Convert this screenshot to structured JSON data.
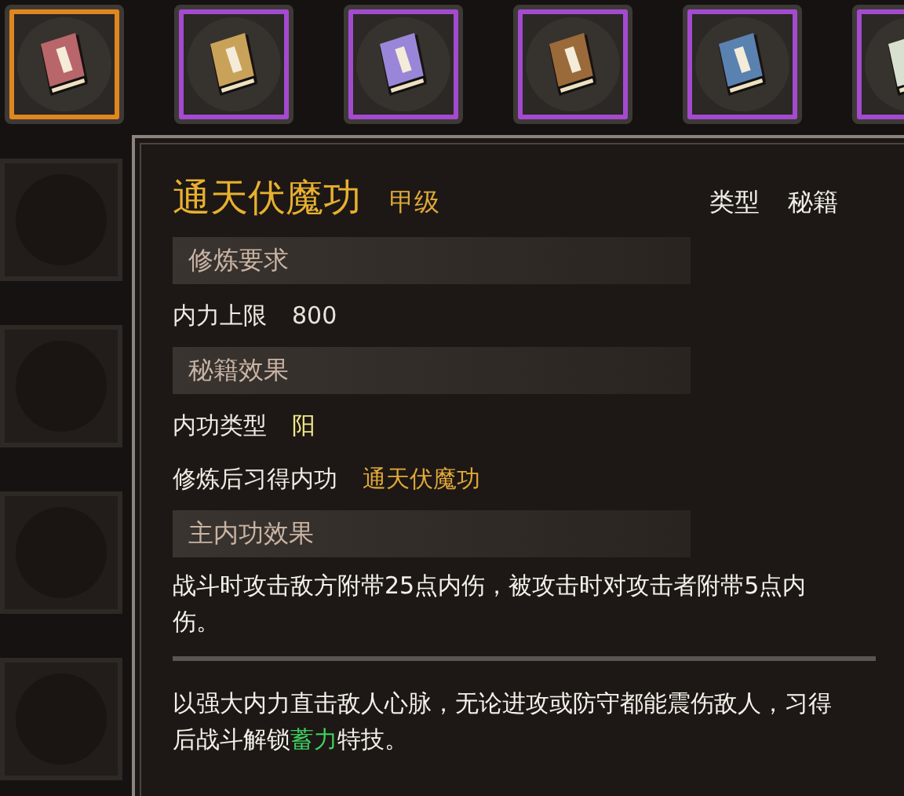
{
  "top_row": [
    {
      "kind": "book",
      "selected": true,
      "color": "#b8666a"
    },
    {
      "kind": "book",
      "selected": false,
      "color": "#c9a25a"
    },
    {
      "kind": "book",
      "selected": false,
      "color": "#9a86d8"
    },
    {
      "kind": "book",
      "selected": false,
      "color": "#9a6a3a"
    },
    {
      "kind": "book",
      "selected": false,
      "color": "#5a82b0"
    },
    {
      "kind": "book",
      "selected": false,
      "color": "#d8e0d0"
    }
  ],
  "side_column": [
    {
      "kind": "empty"
    },
    {
      "kind": "empty"
    },
    {
      "kind": "empty"
    },
    {
      "kind": "empty"
    }
  ],
  "panel": {
    "title": "通天伏魔功",
    "grade": "甲级",
    "type_label": "类型",
    "type_value": "秘籍",
    "sections": [
      {
        "header": "修炼要求",
        "kind": "rows",
        "rows": [
          {
            "label": "内力上限",
            "value": "800",
            "color": "#e8e4dc"
          }
        ]
      },
      {
        "header": "秘籍效果",
        "kind": "rows",
        "rows": [
          {
            "label": "内功类型",
            "value": "阳",
            "color": "#f0e68a"
          },
          {
            "label": "修炼后习得内功",
            "value": "通天伏魔功",
            "color": "#e0a838"
          }
        ]
      },
      {
        "header": "主内功效果",
        "kind": "text",
        "text": "战斗时攻击敌方附带25点内伤，被攻击时对攻击者附带5点内伤。"
      }
    ],
    "description": {
      "before": "以强大内力直击敌人心脉，无论进攻或防守都能震伤敌人，习得后战斗解锁",
      "highlight": "蓄力",
      "after": "特技。"
    }
  }
}
